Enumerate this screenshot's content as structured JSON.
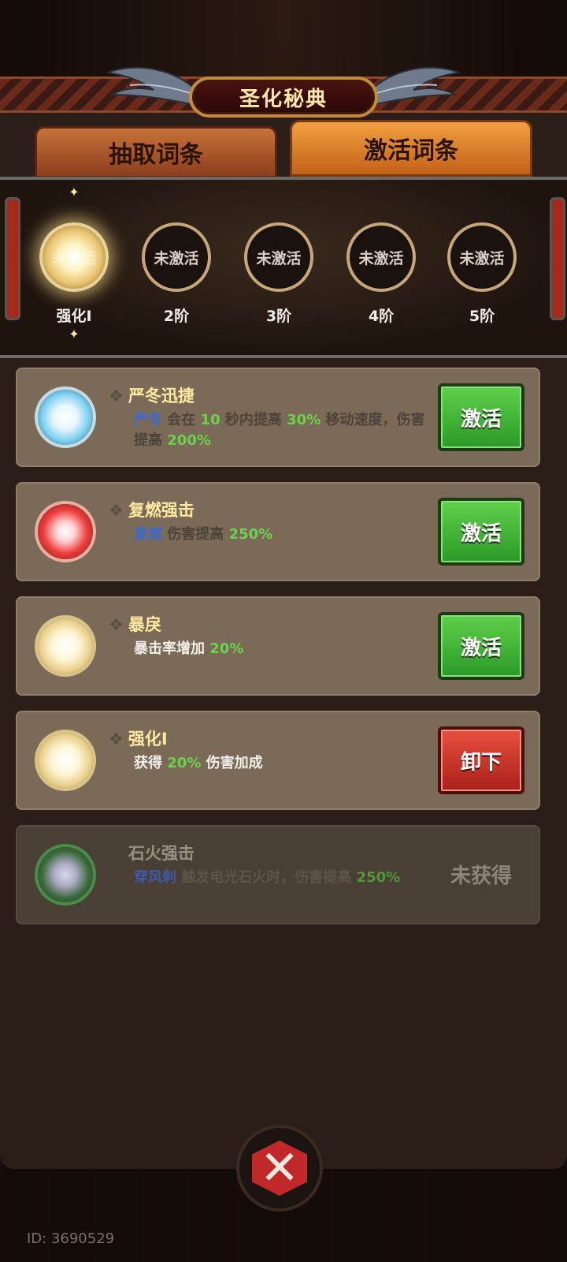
{
  "header": {
    "title": "圣化秘典"
  },
  "tabs": [
    {
      "label": "抽取词条",
      "active": false
    },
    {
      "label": "激活词条",
      "active": true
    }
  ],
  "tiers": [
    {
      "label": "强化Ⅰ",
      "state": "未激活",
      "active": true
    },
    {
      "label": "2阶",
      "state": "未激活",
      "active": false
    },
    {
      "label": "3阶",
      "state": "未激活",
      "active": false
    },
    {
      "label": "4阶",
      "state": "未激活",
      "active": false
    },
    {
      "label": "5阶",
      "state": "未激活",
      "active": false
    }
  ],
  "cards": [
    {
      "title": "严冬迅捷",
      "orb_color": "blue",
      "desc_parts": [
        {
          "text": "严冬",
          "style": "b"
        },
        {
          "text": " 会在 ",
          "style": ""
        },
        {
          "text": "10",
          "style": "g"
        },
        {
          "text": " 秒内提高 ",
          "style": ""
        },
        {
          "text": "30%",
          "style": "g"
        },
        {
          "text": " 移动速度，伤害提高 ",
          "style": ""
        },
        {
          "text": "200%",
          "style": "g"
        }
      ],
      "button": {
        "label": "激活",
        "type": "green"
      }
    },
    {
      "title": "复燃强击",
      "orb_color": "red",
      "desc_parts": [
        {
          "text": "复燃",
          "style": "b"
        },
        {
          "text": " 伤害提高 ",
          "style": ""
        },
        {
          "text": "250%",
          "style": "g"
        }
      ],
      "button": {
        "label": "激活",
        "type": "green"
      }
    },
    {
      "title": "暴戾",
      "orb_color": "gold",
      "desc_parts": [
        {
          "text": "暴击率增加 ",
          "style": "w"
        },
        {
          "text": "20%",
          "style": "g"
        }
      ],
      "button": {
        "label": "激活",
        "type": "green"
      }
    },
    {
      "title": "强化Ⅰ",
      "orb_color": "gold",
      "desc_parts": [
        {
          "text": "获得 ",
          "style": "w"
        },
        {
          "text": "20%",
          "style": "g"
        },
        {
          "text": " 伤害加成",
          "style": "w"
        }
      ],
      "button": {
        "label": "卸下",
        "type": "red"
      }
    },
    {
      "title": "石火强击",
      "orb_color": "green",
      "disabled": true,
      "desc_parts": [
        {
          "text": "穿风刺",
          "style": "b"
        },
        {
          "text": " 触发电光石火时，伤害提高 ",
          "style": ""
        },
        {
          "text": "250%",
          "style": "g"
        }
      ],
      "status": "未获得"
    }
  ],
  "footer": {
    "id_text": "ID: 3690529"
  },
  "icons": {
    "close": "close-x-icon",
    "diamond": "❖"
  }
}
